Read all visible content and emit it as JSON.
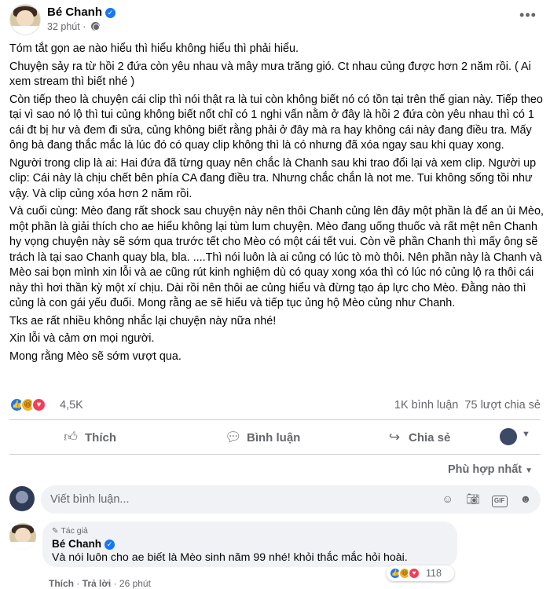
{
  "post": {
    "author": "Bé Chanh",
    "time": "32 phút",
    "more_icon": "ellipsis-icon",
    "paragraphs": [
      "Tóm tắt gọn ae nào hiểu thì hiểu không hiểu thì phải hiểu.",
      "Chuyện sảy ra từ hồi 2 đứa còn yêu nhau và mây mưa trăng gió. Ct nhau củng được hơn 2 năm rồi. ( Ai xem stream thì biết nhé )",
      "Còn tiếp theo là chuyện cái clip thì nói thật ra là tui còn không biết nó có tồn tại trên thế gian này. Tiếp theo tại vì sao nó lộ thì tui củng không biết nốt chỉ có 1 nghi vấn nằm ở đây là hồi 2 đứa còn yêu nhau thì có 1 cái đt bị hư và đem đi sửa, củng không biết rằng phải ở đây mà ra hay không cái này đang điều tra. Mấy ông bà đang thắc mắc là lúc đó có quay clip không thì là có nhưng đã xóa ngay sau khi quay xong.",
      "Người trong clip là ai: Hai đứa đã từng quay nên chắc là Chanh sau khi trao đổi lại và xem clip. Người up clip: Cái này là chịu chết bên phía CA đang điều tra. Nhưng chắc chắn là not me. Tui không sống tồi như vậy. Và clip củng xóa hơn 2 năm rồi.",
      "Và cuối cùng: Mèo đang rất shock sau chuyện này nên thôi Chanh củng lên đây một phần là để an ủi Mèo, một phần là giải thích cho ae hiểu không lại tùm lum chuyện. Mèo đang uống thuốc và rất mệt nên Chanh hy vọng chuyện này sẽ sớm qua trước tết cho Mèo có một cái tết vui. Còn về phần Chanh thì mấy ông sẽ trách là tại sao Chanh quay bla, bla. ....Thì nói luôn là ai củng có lúc tò mò thôi. Nên phần này là Chanh và Mèo sai bọn mình xin lỗi và ae cũng rút kinh nghiệm dù có quay xong xóa thì có lúc nó củng lộ ra thôi cái này thì hơi thần kỳ một xí chịu. Dài rồi nên thôi ae củng hiểu và đừng tạo áp lực cho Mèo. Đằng nào thì củng là con gái yếu đuối. Mong rằng ae sẽ hiểu và tiếp tục ủng hộ Mèo củng như Chanh.",
      "Tks ae rất nhiều không nhắc lại chuyện này nữa nhé!",
      "Xin lỗi và cảm ơn mọi người.",
      "Mong rằng Mèo sẽ sớm vượt qua."
    ],
    "reactions": {
      "count": "4,5K",
      "icons": [
        "like-icon",
        "haha-icon",
        "love-icon"
      ]
    },
    "comment_count": "1K bình luận",
    "share_count": "75 lượt chia sẻ",
    "actions": {
      "like": "Thích",
      "comment": "Bình luận",
      "share": "Chia sẻ"
    },
    "sort_label": "Phù hợp nhất",
    "composer_placeholder": "Viết bình luận...",
    "composer_icons": [
      "emoji-icon",
      "camera-icon",
      "gif-icon",
      "sticker-icon"
    ]
  },
  "comment": {
    "badge": "Tác giả",
    "author": "Bé Chanh",
    "text": "Và nói luôn cho ae biết là Mèo sinh năm 99 nhé! khỏi thắc mắc hỏi hoài.",
    "reaction_count": "118",
    "like_action": "Thích",
    "reply_action": "Trả lời",
    "time": "26 phút"
  },
  "colors": {
    "accent": "#1877f2",
    "secondary_text": "#65676b",
    "bubble": "#f0f2f5"
  }
}
